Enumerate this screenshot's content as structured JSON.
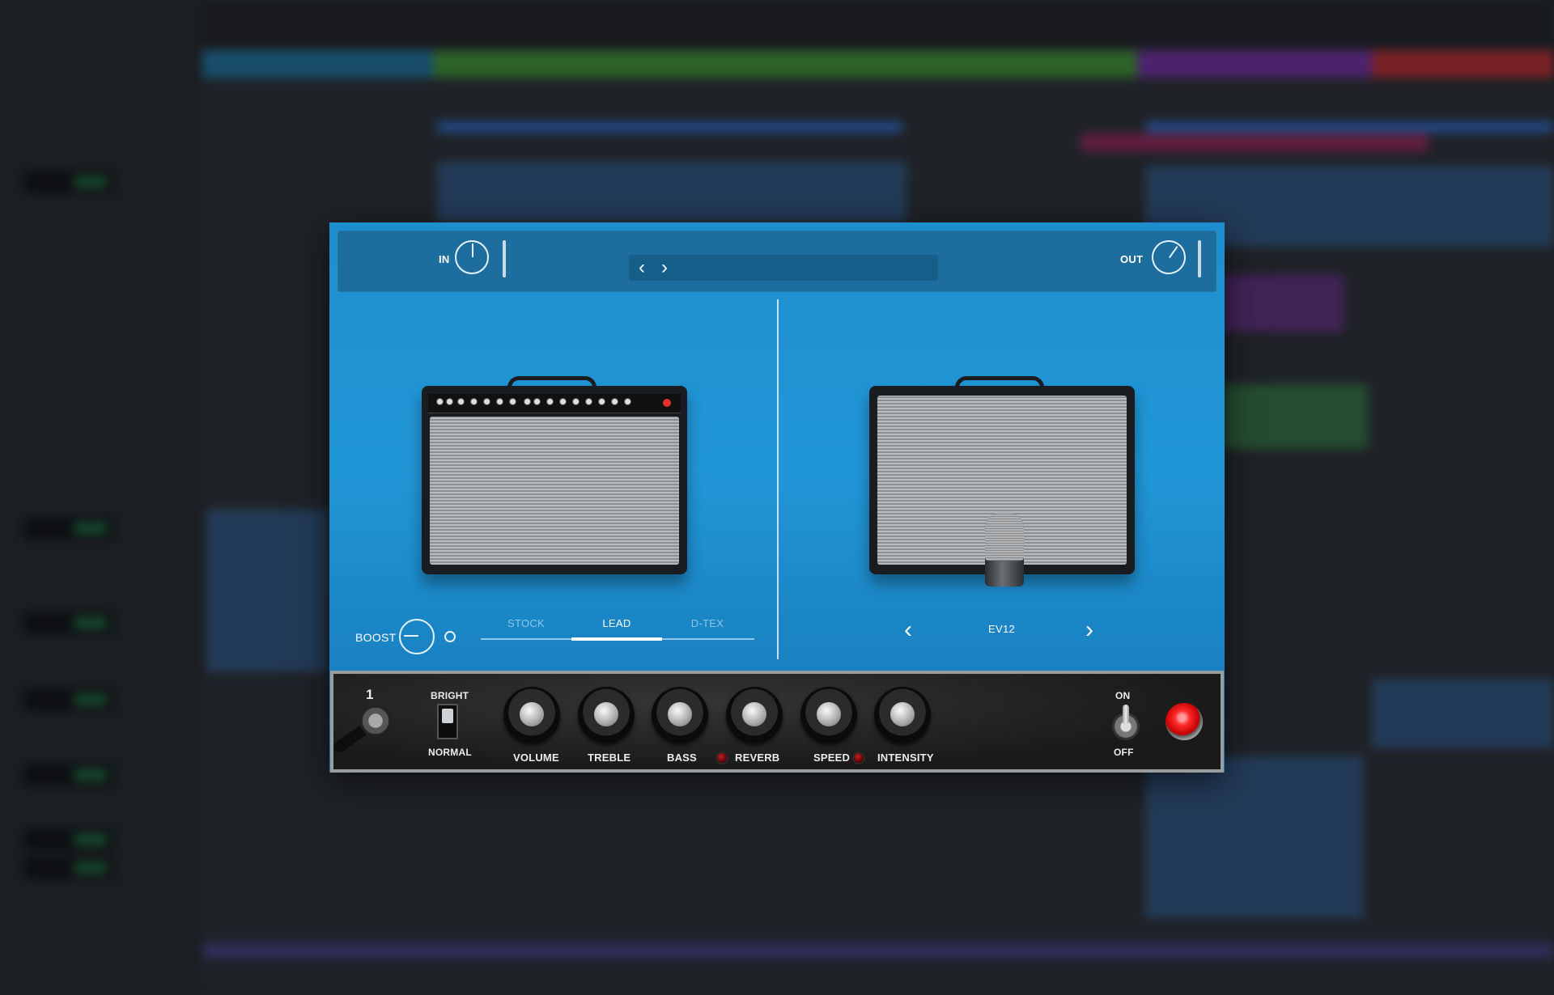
{
  "plugin": {
    "top_bar": {
      "in_label": "IN",
      "out_label": "OUT",
      "preset_prev": "‹",
      "preset_next": "›",
      "preset_name": ""
    },
    "amp_tabs": [
      {
        "label": "STOCK",
        "active": false
      },
      {
        "label": "LEAD",
        "active": true
      },
      {
        "label": "D-TEX",
        "active": false
      }
    ],
    "boost_label": "BOOST",
    "cab": {
      "name": "EV12",
      "prev": "‹",
      "next": "›"
    },
    "front_panel": {
      "input_number": "1",
      "bright_label": "BRIGHT",
      "normal_label": "NORMAL",
      "knobs": [
        "VOLUME",
        "TREBLE",
        "BASS",
        "REVERB",
        "SPEED",
        "INTENSITY"
      ],
      "on_label": "ON",
      "off_label": "OFF"
    },
    "colors": {
      "accent": "#2196d6",
      "top_bar": "#1d6e9f",
      "power_led": "#ff2a2a"
    }
  }
}
